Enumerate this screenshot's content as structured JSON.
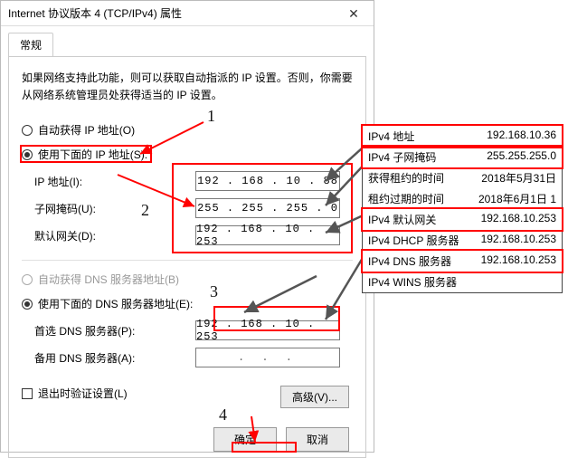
{
  "window": {
    "title": "Internet 协议版本 4 (TCP/IPv4) 属性",
    "close_glyph": "✕"
  },
  "tabs": {
    "general": "常规"
  },
  "instruction": "如果网络支持此功能，则可以获取自动指派的 IP 设置。否则，你需要从网络系统管理员处获得适当的 IP 设置。",
  "radios": {
    "auto_ip": "自动获得 IP 地址(O)",
    "manual_ip": "使用下面的 IP 地址(S):",
    "auto_dns": "自动获得 DNS 服务器地址(B)",
    "manual_dns": "使用下面的 DNS 服务器地址(E):"
  },
  "fields": {
    "ip_label": "IP 地址(I):",
    "ip_value": "192 . 168 .  10  .  88",
    "mask_label": "子网掩码(U):",
    "mask_value": "255 . 255 . 255 .   0",
    "gateway_label": "默认网关(D):",
    "gateway_value": "192 . 168 .  10  . 253",
    "dns1_label": "首选 DNS 服务器(P):",
    "dns1_value": "192 . 168 .  10  . 253",
    "dns2_label": "备用 DNS 服务器(A):",
    "dns2_value": ".     .     ."
  },
  "checkbox": {
    "validate": "退出时验证设置(L)"
  },
  "buttons": {
    "advanced": "高级(V)...",
    "ok": "确定",
    "cancel": "取消"
  },
  "annotations": {
    "n1": "1",
    "n2": "2",
    "n3": "3",
    "n4": "4"
  },
  "info_panel": {
    "rows": [
      {
        "k": "IPv4 地址",
        "v": "192.168.10.36",
        "hl": true
      },
      {
        "k": "IPv4 子网掩码",
        "v": "255.255.255.0",
        "hl": true
      },
      {
        "k": "获得租约的时间",
        "v": "2018年5月31日",
        "hl": false
      },
      {
        "k": "租约过期的时间",
        "v": "2018年6月1日 1",
        "hl": false
      },
      {
        "k": "IPv4 默认网关",
        "v": "192.168.10.253",
        "hl": true
      },
      {
        "k": "IPv4 DHCP 服务器",
        "v": "192.168.10.253",
        "hl": false
      },
      {
        "k": "IPv4 DNS 服务器",
        "v": "192.168.10.253",
        "hl": true
      },
      {
        "k": "IPv4 WINS 服务器",
        "v": "",
        "hl": false
      }
    ]
  }
}
